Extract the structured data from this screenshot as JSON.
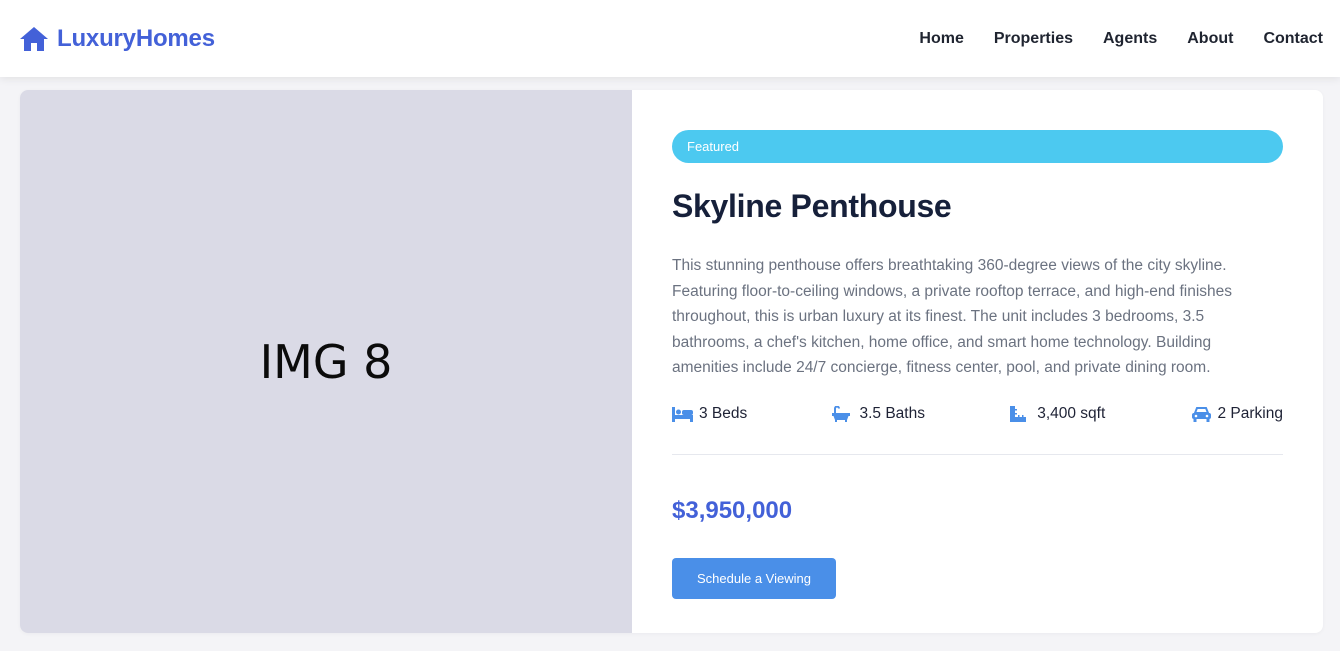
{
  "brand": {
    "name": "LuxuryHomes",
    "icon": "home-icon",
    "color": "#4361d8"
  },
  "nav": {
    "items": [
      {
        "label": "Home"
      },
      {
        "label": "Properties"
      },
      {
        "label": "Agents"
      },
      {
        "label": "About"
      },
      {
        "label": "Contact"
      }
    ]
  },
  "listing": {
    "image_label": "IMG 8",
    "badge": "Featured",
    "badge_color": "#4cc9f0",
    "title": "Skyline Penthouse",
    "description": "This stunning penthouse offers breathtaking 360-degree views of the city skyline. Featuring floor-to-ceiling windows, a private rooftop terrace, and high-end finishes throughout, this is urban luxury at its finest. The unit includes 3 bedrooms, 3.5 bathrooms, a chef's kitchen, home office, and smart home technology. Building amenities include 24/7 concierge, fitness center, pool, and private dining room.",
    "features": [
      {
        "icon": "bed-icon",
        "label": "3 Beds"
      },
      {
        "icon": "bath-icon",
        "label": "3.5 Baths"
      },
      {
        "icon": "ruler-icon",
        "label": "3,400 sqft"
      },
      {
        "icon": "car-icon",
        "label": "2 Parking"
      }
    ],
    "price": "$3,950,000",
    "cta_label": "Schedule a Viewing",
    "accent_color": "#4a8fe8"
  }
}
